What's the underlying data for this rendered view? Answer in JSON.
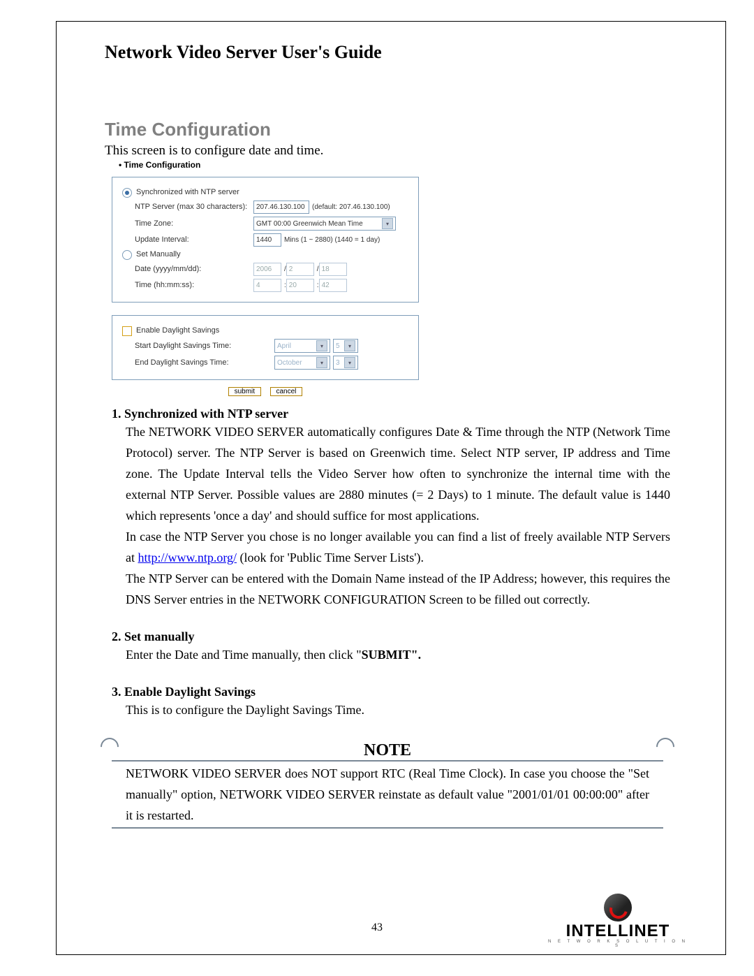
{
  "header": {
    "title": "Network Video Server User's Guide"
  },
  "section_title": "Time Configuration",
  "intro": "This screen is to configure date and time.",
  "panel_label": "Time Configuration",
  "panel": {
    "ntp": {
      "radio_label": "Synchronized with NTP server",
      "server_label": "NTP Server (max 30 characters):",
      "server_value": "207.46.130.100",
      "server_default": "(default: 207.46.130.100)",
      "tz_label": "Time Zone:",
      "tz_value": "GMT 00:00 Greenwich Mean Time",
      "interval_label": "Update Interval:",
      "interval_value": "1440",
      "interval_hint": "Mins (1 ~ 2880) (1440 = 1 day)"
    },
    "manual": {
      "radio_label": "Set Manually",
      "date_label": "Date (yyyy/mm/dd):",
      "date_y": "2006",
      "date_m": "2",
      "date_d": "18",
      "time_label": "Time (hh:mm:ss):",
      "time_h": "4",
      "time_m": "20",
      "time_s": "42"
    },
    "dst": {
      "enable_label": "Enable Daylight Savings",
      "start_label": "Start Daylight Savings Time:",
      "start_month": "April",
      "start_day": "5",
      "end_label": "End Daylight Savings Time:",
      "end_month": "October",
      "end_day": "3"
    },
    "submit": "submit",
    "cancel": "cancel"
  },
  "items": {
    "one_h": "1. Synchronized with NTP server",
    "one_p1": "The NETWORK VIDEO SERVER automatically configures Date & Time through the NTP (Network Time Protocol) server. The NTP Server is based on Greenwich time. Select NTP server, IP address and Time zone. The Update Interval tells the Video Server how often to synchronize the internal time with the external NTP Server. Possible values are 2880 minutes (= 2 Days) to 1 minute. The default value is 1440 which represents 'once a day' and should suffice for most applications.",
    "one_p2a": "In case the NTP Server you chose is no longer available you can find a list of freely available NTP Servers at ",
    "one_link": "http://www.ntp.org/",
    "one_p2b": " (look for 'Public Time Server Lists').",
    "one_p3": "The NTP Server can be entered with the Domain Name instead of the IP Address; however, this requires the DNS Server entries in the NETWORK CONFIGURATION Screen to be filled out correctly.",
    "two_h": "2. Set manually",
    "two_p_a": "Enter the Date and Time manually, then click \"",
    "two_bold": "SUBMIT\".",
    "three_h": "3. Enable Daylight Savings",
    "three_p": "This is to configure the Daylight Savings Time."
  },
  "note": {
    "title": "NOTE",
    "body": "NETWORK VIDEO SERVER does NOT support RTC (Real Time Clock). In case you choose the \"Set manually\" option, NETWORK VIDEO SERVER reinstate as default value \"2001/01/01 00:00:00\" after it is restarted."
  },
  "page_num": "43",
  "logo": {
    "name": "INTELLINET",
    "sub": "N E T W O R K   S O L U T I O N S"
  }
}
